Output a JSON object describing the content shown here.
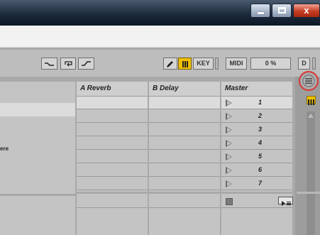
{
  "window": {
    "buttons": [
      {
        "icon": "minimize-icon"
      },
      {
        "icon": "maximize-icon"
      },
      {
        "icon": "close-icon",
        "label": "x"
      }
    ]
  },
  "toolbar": {
    "curve_buttons": [
      "draw-curve-icon",
      "loop-icon",
      "ramp-icon"
    ],
    "pencil_icon": "pencil-icon",
    "pause_icon": "pause-icon",
    "key_label": "KEY",
    "midi_label": "MIDI",
    "cpu_value": "0 %",
    "d_label": "D"
  },
  "mixer": {
    "left_label": "ere",
    "columns": [
      {
        "title": "A Reverb"
      },
      {
        "title": "B Delay"
      },
      {
        "title": "Master"
      }
    ],
    "scenes": [
      "1",
      "2",
      "3",
      "4",
      "5",
      "6",
      "7"
    ]
  },
  "side": {
    "menu_icon": "menu-icon",
    "pause_icon": "pause-icon",
    "scroll_icon": "scroll-up-icon"
  },
  "colors": {
    "accent_yellow": "#F0C000",
    "highlight_circle": "#D93636"
  }
}
